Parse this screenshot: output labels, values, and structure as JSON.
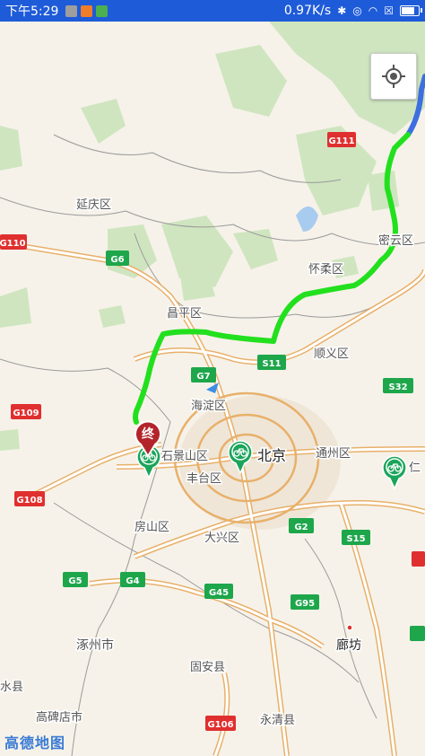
{
  "status_bar": {
    "time": "下午5:29",
    "net_speed": "0.97K/s"
  },
  "map": {
    "cities": {
      "beijing": "北京",
      "langfang": "廊坊",
      "zhuozhou": "涿州市"
    },
    "districts": {
      "yanqing": "延庆区",
      "changping": "昌平区",
      "huairou": "怀柔区",
      "miyun": "密云区",
      "shunyi": "顺义区",
      "haidian": "海淀区",
      "shijingshan": "石景山区",
      "fengtai": "丰台区",
      "tongzhou": "通州区",
      "fangshan": "房山区",
      "daxing": "大兴区",
      "gu_an": "固安县",
      "yongqing": "永清县",
      "gaobeidian": "高碑店市",
      "shui": "水县"
    },
    "roads": [
      "G111",
      "G110",
      "G6",
      "G7",
      "S11",
      "S32",
      "G109",
      "G108",
      "G2",
      "S15",
      "G5",
      "G4",
      "G45",
      "G95",
      "G106"
    ],
    "end_marker_label": "终",
    "partial_label": "仁",
    "route_color": "#22e01e",
    "route_start_color": "#3d6fe0"
  },
  "locate_button": {
    "icon": "crosshair-icon"
  },
  "logo": "高德地图"
}
